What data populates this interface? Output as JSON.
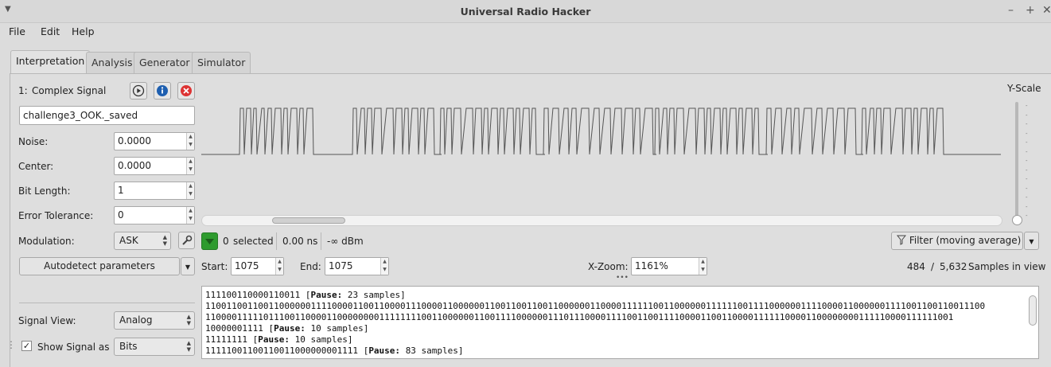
{
  "window": {
    "title": "Universal Radio Hacker",
    "controls": [
      "–",
      "+",
      "✕"
    ]
  },
  "menu": [
    "File",
    "Edit",
    "Help"
  ],
  "tabs": [
    "Interpretation",
    "Analysis",
    "Generator",
    "Simulator"
  ],
  "signal": {
    "index_label": "1:",
    "type_label": "Complex Signal",
    "name": "challenge3_OOK._saved",
    "icons": [
      "play-icon",
      "info-icon",
      "close-icon"
    ]
  },
  "params": {
    "noise_label": "Noise:",
    "noise_value": "0.0000",
    "center_label": "Center:",
    "center_value": "0.0000",
    "bitlength_label": "Bit Length:",
    "bitlength_value": "1",
    "tolerance_label": "Error Tolerance:",
    "tolerance_value": "0",
    "modulation_label": "Modulation:",
    "modulation_value": "ASK",
    "autodetect_label": "Autodetect parameters"
  },
  "view": {
    "signal_view_label": "Signal View:",
    "signal_view_value": "Analog",
    "show_signal_label": "Show Signal as",
    "show_signal_checked": true,
    "show_signal_value": "Bits"
  },
  "yscale_label": "Y-Scale",
  "selection": {
    "selected_count": "0",
    "selected_label": "selected",
    "duration": "0.00 ns",
    "power": "-∞ dBm",
    "filter_label": "Filter (moving average)"
  },
  "range": {
    "start_label": "Start:",
    "start_value": "1075",
    "end_label": "End:",
    "end_value": "1075",
    "zoom_label": "X-Zoom:",
    "zoom_value": "1161%",
    "samples_shown": "484",
    "samples_sep": "/",
    "samples_total": "5,632",
    "samples_label": "Samples in view"
  },
  "protocol_lines": [
    {
      "bits": "111100110000110011 ",
      "pause": "23 samples"
    },
    {
      "bits": "1100110011001100000011110000110011000011100001100000011001100110011000000110000111111001100000011111100111100000011110000110000001111001100110011100",
      "pause": null
    },
    {
      "bits": "1100001111101110011000011000000001111111100110000001100111100000011101110000111100110011110000110011000011111100001100000000111110000111111001",
      "pause": null
    },
    {
      "bits": "10000001111 ",
      "pause": "10 samples"
    },
    {
      "bits": "11111111 ",
      "pause": "10 samples"
    },
    {
      "bits": "11111001100110011000000001111 ",
      "pause": "83 samples"
    }
  ],
  "pause_word": "Pause:",
  "colors": {
    "background": "#dcdcdc",
    "signal_line": "#555555",
    "close_icon": "#d33",
    "info_icon": "#1e5fb0",
    "selection_icon": "#2e9b2e"
  }
}
